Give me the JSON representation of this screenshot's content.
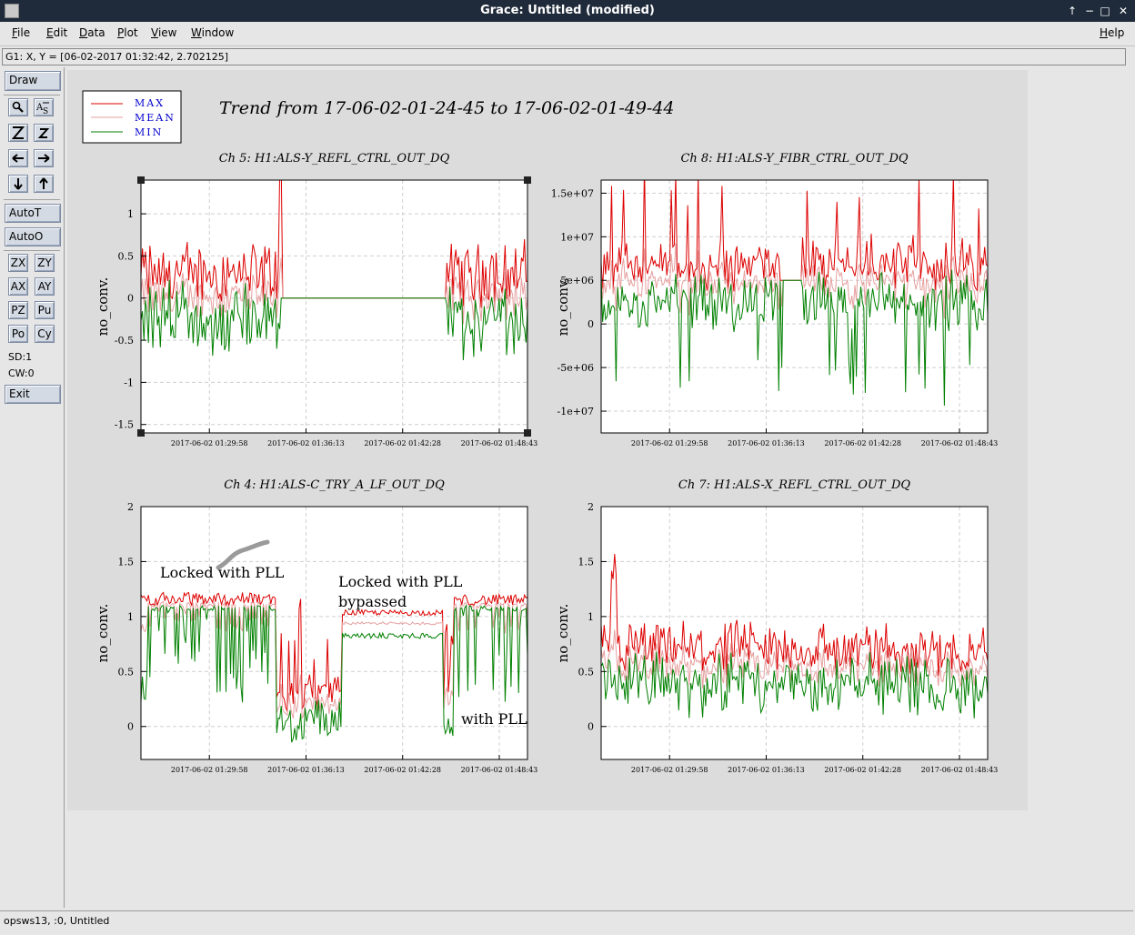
{
  "window": {
    "title": "Grace: Untitled (modified)",
    "buttons": [
      "↑",
      "−",
      "□",
      "✕"
    ]
  },
  "menu": [
    {
      "label": "File",
      "u": "F",
      "rest": "ile"
    },
    {
      "label": "Edit",
      "u": "E",
      "rest": "dit"
    },
    {
      "label": "Data",
      "u": "D",
      "rest": "ata"
    },
    {
      "label": "Plot",
      "u": "P",
      "rest": "lot"
    },
    {
      "label": "View",
      "u": "V",
      "rest": "iew"
    },
    {
      "label": "Window",
      "u": "W",
      "rest": "indow"
    },
    {
      "label": "Help",
      "u": "H",
      "rest": "elp"
    }
  ],
  "locator": "G1: X, Y = [06-02-2017 01:32:42, 2.702125]",
  "toolbar": {
    "draw": "Draw",
    "icons": [
      {
        "name": "zoom-tool-icon",
        "glyph": "🔍"
      },
      {
        "name": "autoscale-icon",
        "glyph": "Aᵪ"
      },
      {
        "name": "zoom-in-icon",
        "glyph": "Z"
      },
      {
        "name": "zoom-out-icon",
        "glyph": "z"
      },
      {
        "name": "arrow-left-icon",
        "glyph": "←"
      },
      {
        "name": "arrow-right-icon",
        "glyph": "→"
      },
      {
        "name": "arrow-down-icon",
        "glyph": "↓"
      },
      {
        "name": "arrow-up-icon",
        "glyph": "↑"
      }
    ],
    "autot": "AutoT",
    "autoo": "AutoO",
    "grid": [
      "ZX",
      "ZY",
      "AX",
      "AY",
      "PZ",
      "Pu",
      "Po",
      "Cy"
    ],
    "sd": "SD:1",
    "cw": "CW:0",
    "exit": "Exit"
  },
  "status": "opsws13, :0, Untitled",
  "plot": {
    "title": "Trend from 17-06-02-01-24-45 to 17-06-02-01-49-44",
    "legend": [
      {
        "label": "MAX",
        "color": "#dd0000"
      },
      {
        "label": "MEAN",
        "color": "#e6a0a0"
      },
      {
        "label": "MIN",
        "color": "#008000"
      }
    ],
    "ylabel": "no_conv.",
    "xticks": [
      "2017-06-02 01:29:58",
      "2017-06-02 01:36:13",
      "2017-06-02 01:42:28",
      "2017-06-02 01:48:43"
    ],
    "annotations": [
      "Locked with PLL",
      "Locked with PLL",
      "bypassed",
      "with PLL"
    ]
  },
  "chart_data": [
    {
      "type": "line",
      "title": "Ch 5: H1:ALS-Y_REFL_CTRL_OUT_DQ",
      "ylabel": "no_conv.",
      "x": [
        "2017-06-02 01:29:58",
        "2017-06-02 01:36:13",
        "2017-06-02 01:42:28",
        "2017-06-02 01:48:43"
      ],
      "yticks": [
        "1",
        "0.5",
        "0",
        "-0.5",
        "-1",
        "-1.5"
      ],
      "ylim": [
        -1.5,
        1.5
      ],
      "series": [
        {
          "name": "MAX"
        },
        {
          "name": "MEAN"
        },
        {
          "name": "MIN"
        }
      ]
    },
    {
      "type": "line",
      "title": "Ch 8: H1:ALS-Y_FIBR_CTRL_OUT_DQ",
      "ylabel": "no_conv.",
      "x": [
        "2017-06-02 01:29:58",
        "2017-06-02 01:36:13",
        "2017-06-02 01:42:28",
        "2017-06-02 01:48:43"
      ],
      "yticks": [
        "1.5e+07",
        "1e+07",
        "5e+06",
        "0",
        "-5e+06",
        "-1e+07"
      ],
      "ylim": [
        -12000000,
        16500000
      ],
      "series": [
        {
          "name": "MAX"
        },
        {
          "name": "MEAN"
        },
        {
          "name": "MIN"
        }
      ]
    },
    {
      "type": "line",
      "title": "Ch 4: H1:ALS-C_TRY_A_LF_OUT_DQ",
      "ylabel": "no_conv.",
      "x": [
        "2017-06-02 01:29:58",
        "2017-06-02 01:36:13",
        "2017-06-02 01:42:28",
        "2017-06-02 01:48:43"
      ],
      "yticks": [
        "2",
        "1.5",
        "1",
        "0.5",
        "0"
      ],
      "ylim": [
        -0.3,
        2
      ],
      "series": [
        {
          "name": "MAX"
        },
        {
          "name": "MEAN"
        },
        {
          "name": "MIN"
        }
      ]
    },
    {
      "type": "line",
      "title": "Ch 7: H1:ALS-X_REFL_CTRL_OUT_DQ",
      "ylabel": "no_conv.",
      "x": [
        "2017-06-02 01:29:58",
        "2017-06-02 01:36:13",
        "2017-06-02 01:42:28",
        "2017-06-02 01:48:43"
      ],
      "yticks": [
        "2",
        "1.5",
        "1",
        "0.5",
        "0"
      ],
      "ylim": [
        -0.3,
        2
      ],
      "series": [
        {
          "name": "MAX"
        },
        {
          "name": "MEAN"
        },
        {
          "name": "MIN"
        }
      ]
    }
  ]
}
